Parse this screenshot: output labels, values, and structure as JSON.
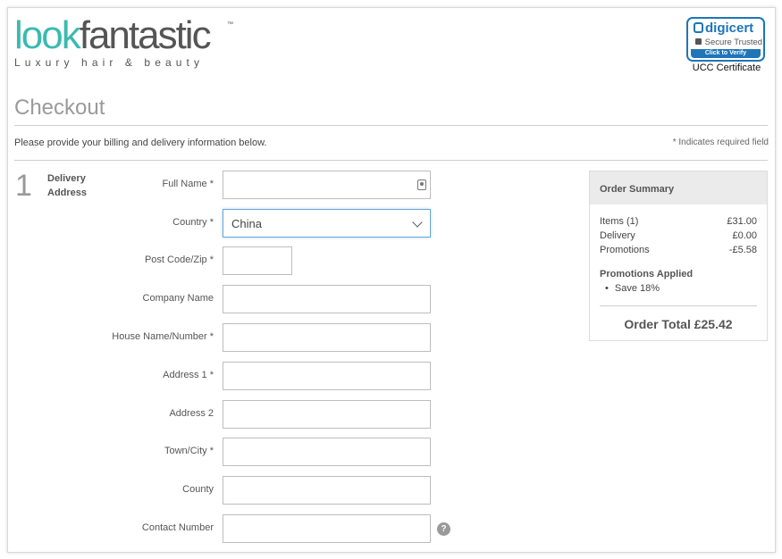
{
  "brand": {
    "word1": "look",
    "word2": "fantastic",
    "trademark": "™",
    "tagline": "Luxury hair & beauty"
  },
  "badge": {
    "brand": "digicert",
    "trust_text": "Secure Trusted",
    "verify": "Click to Verify",
    "caption": "UCC Certificate"
  },
  "page": {
    "title": "Checkout",
    "intro": "Please provide your billing and delivery information below.",
    "required_note": "* Indicates required field"
  },
  "step": {
    "number": "1",
    "label": "Delivery Address"
  },
  "form": {
    "full_name": {
      "label": "Full Name *",
      "value": ""
    },
    "country": {
      "label": "Country *",
      "value": "China"
    },
    "post_code": {
      "label": "Post Code/Zip *",
      "value": ""
    },
    "company": {
      "label": "Company Name",
      "value": ""
    },
    "house": {
      "label": "House Name/Number *",
      "value": ""
    },
    "address1": {
      "label": "Address 1 *",
      "value": ""
    },
    "address2": {
      "label": "Address 2",
      "value": ""
    },
    "town": {
      "label": "Town/City *",
      "value": ""
    },
    "county": {
      "label": "County",
      "value": ""
    },
    "contact": {
      "label": "Contact Number",
      "value": "",
      "help": "?"
    }
  },
  "summary": {
    "title": "Order Summary",
    "items": {
      "label": "Items (1)",
      "value": "£31.00"
    },
    "delivery": {
      "label": "Delivery",
      "value": "£0.00"
    },
    "promotions": {
      "label": "Promotions",
      "value": "-£5.58"
    },
    "promotions_applied_title": "Promotions Applied",
    "promotions_applied": [
      "Save 18%"
    ],
    "total": "Order Total £25.42"
  },
  "colors": {
    "brand_teal": "#3bbab0",
    "digicert_blue": "#1f75b8"
  }
}
